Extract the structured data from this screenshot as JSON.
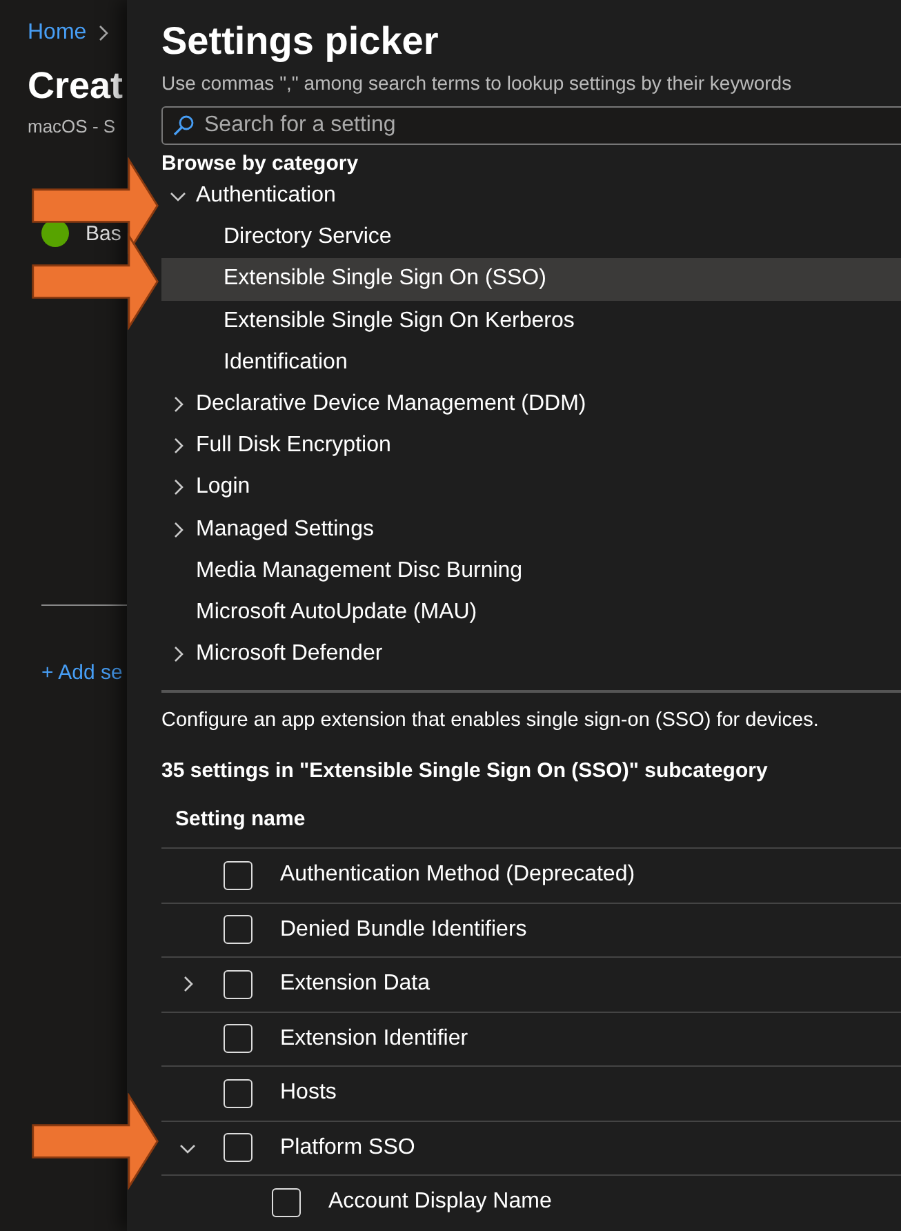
{
  "background_page": {
    "breadcrumb": "Home",
    "title": "Creat",
    "subtitle": "macOS - S",
    "step": {
      "label": "Bas",
      "done": true
    },
    "add_link": "+ Add se"
  },
  "picker": {
    "title": "Settings picker",
    "hint": "Use commas \",\" among search terms to lookup settings by their keywords",
    "search": {
      "placeholder": "Search for a setting"
    },
    "browse_heading": "Browse by category",
    "categories": [
      {
        "label": "Authentication",
        "expanded": true,
        "selected": false,
        "children": [
          {
            "label": "Directory Service",
            "selected": false
          },
          {
            "label": "Extensible Single Sign On (SSO)",
            "selected": true
          },
          {
            "label": "Extensible Single Sign On Kerberos",
            "selected": false
          },
          {
            "label": "Identification",
            "selected": false
          }
        ]
      },
      {
        "label": "Declarative Device Management (DDM)",
        "expanded": false,
        "selected": false
      },
      {
        "label": "Full Disk Encryption",
        "expanded": false,
        "selected": false
      },
      {
        "label": "Login",
        "expanded": false,
        "selected": false
      },
      {
        "label": "Managed Settings",
        "expanded": false,
        "selected": false
      },
      {
        "label": "Media Management Disc Burning",
        "selected": false
      },
      {
        "label": "Microsoft AutoUpdate (MAU)",
        "selected": false
      },
      {
        "label": "Microsoft Defender",
        "expanded": false,
        "selected": false
      }
    ],
    "description": "Configure an app extension that enables single sign-on (SSO) for devices.",
    "count": "35 settings in \"Extensible Single Sign On (SSO)\" subcategory",
    "column": "Setting name",
    "settings": [
      {
        "label": "Authentication Method (Deprecated)",
        "checked": false
      },
      {
        "label": "Denied Bundle Identifiers",
        "checked": false
      },
      {
        "label": "Extension Data",
        "checked": false,
        "expanded": false
      },
      {
        "label": "Extension Identifier",
        "checked": false
      },
      {
        "label": "Hosts",
        "checked": false
      },
      {
        "label": "Platform SSO",
        "checked": false,
        "expanded": true,
        "children": [
          {
            "label": "Account Display Name",
            "checked": false
          }
        ]
      }
    ]
  }
}
